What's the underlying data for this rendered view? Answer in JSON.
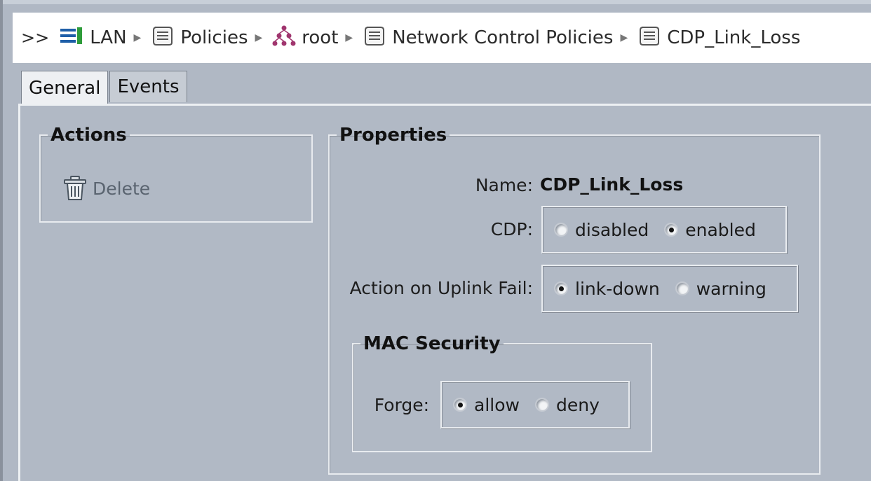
{
  "breadcrumb": {
    "expand": ">>",
    "items": [
      {
        "label": "LAN",
        "icon": "lan-list-icon"
      },
      {
        "label": "Policies",
        "icon": "policy-scroll-icon"
      },
      {
        "label": "root",
        "icon": "org-tree-icon"
      },
      {
        "label": "Network Control Policies",
        "icon": "policy-scroll-icon"
      },
      {
        "label": "CDP_Link_Loss",
        "icon": "policy-scroll-icon"
      }
    ]
  },
  "tabs": [
    {
      "label": "General",
      "active": true
    },
    {
      "label": "Events",
      "active": false
    }
  ],
  "actions": {
    "title": "Actions",
    "delete_label": "Delete"
  },
  "properties": {
    "title": "Properties",
    "name_label": "Name:",
    "name_value": "CDP_Link_Loss",
    "cdp": {
      "label": "CDP:",
      "options": [
        "disabled",
        "enabled"
      ],
      "selected": "enabled"
    },
    "uplink": {
      "label": "Action on Uplink Fail:",
      "options": [
        "link-down",
        "warning"
      ],
      "selected": "link-down"
    },
    "mac_security": {
      "title": "MAC Security",
      "forge_label": "Forge:",
      "options": [
        "allow",
        "deny"
      ],
      "selected": "allow"
    }
  }
}
